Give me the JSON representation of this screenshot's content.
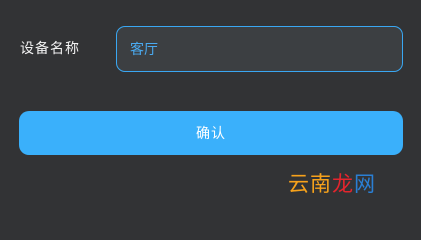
{
  "form": {
    "device_name_label": "设备名称",
    "device_name_value": "客厅",
    "confirm_label": "确认"
  },
  "watermark": {
    "text": "云南龙网",
    "part_1": "云南",
    "part_2": "龙",
    "part_3": "网"
  },
  "colors": {
    "background": "#323335",
    "input_border": "#3aa7f2",
    "input_text": "#4aaaf0",
    "button": "#3ab0fb",
    "watermark_1": "#f7a21b",
    "watermark_2": "#e4252d",
    "watermark_3": "#2a7fd4"
  }
}
